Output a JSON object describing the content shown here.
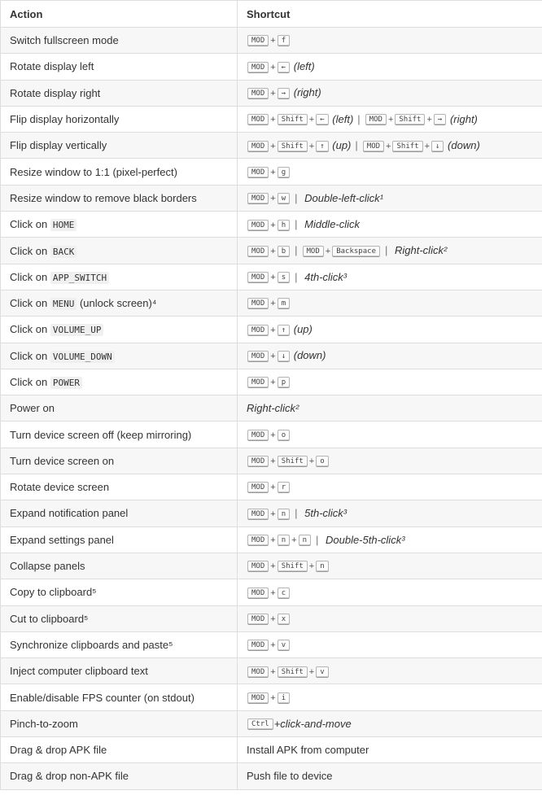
{
  "header": {
    "action": "Action",
    "shortcut": "Shortcut"
  },
  "rows": [
    {
      "action": [
        {
          "t": "Switch fullscreen mode"
        }
      ],
      "shortcut": [
        {
          "k": "MOD"
        },
        {
          "p": "+"
        },
        {
          "k": "f"
        }
      ]
    },
    {
      "action": [
        {
          "t": "Rotate display left"
        }
      ],
      "shortcut": [
        {
          "k": "MOD"
        },
        {
          "p": "+"
        },
        {
          "k": "←"
        },
        {
          "e": "(left)"
        }
      ]
    },
    {
      "action": [
        {
          "t": "Rotate display right"
        }
      ],
      "shortcut": [
        {
          "k": "MOD"
        },
        {
          "p": "+"
        },
        {
          "k": "→"
        },
        {
          "e": "(right)"
        }
      ]
    },
    {
      "action": [
        {
          "t": "Flip display horizontally"
        }
      ],
      "shortcut": [
        {
          "k": "MOD"
        },
        {
          "p": "+"
        },
        {
          "k": "Shift"
        },
        {
          "p": "+"
        },
        {
          "k": "←"
        },
        {
          "e": "(left)"
        },
        {
          "s": "|"
        },
        {
          "k": "MOD"
        },
        {
          "p": "+"
        },
        {
          "k": "Shift"
        },
        {
          "p": "+"
        },
        {
          "k": "→"
        },
        {
          "e": "(right)"
        }
      ]
    },
    {
      "action": [
        {
          "t": "Flip display vertically"
        }
      ],
      "shortcut": [
        {
          "k": "MOD"
        },
        {
          "p": "+"
        },
        {
          "k": "Shift"
        },
        {
          "p": "+"
        },
        {
          "k": "↑"
        },
        {
          "e": "(up)"
        },
        {
          "s": "|"
        },
        {
          "k": "MOD"
        },
        {
          "p": "+"
        },
        {
          "k": "Shift"
        },
        {
          "p": "+"
        },
        {
          "k": "↓"
        },
        {
          "e": "(down)"
        }
      ]
    },
    {
      "action": [
        {
          "t": "Resize window to 1:1 (pixel-perfect)"
        }
      ],
      "shortcut": [
        {
          "k": "MOD"
        },
        {
          "p": "+"
        },
        {
          "k": "g"
        }
      ]
    },
    {
      "action": [
        {
          "t": "Resize window to remove black borders"
        }
      ],
      "shortcut": [
        {
          "k": "MOD"
        },
        {
          "p": "+"
        },
        {
          "k": "w"
        },
        {
          "s": "|"
        },
        {
          "e": "Double-left-click¹"
        }
      ]
    },
    {
      "action": [
        {
          "t": "Click on "
        },
        {
          "c": "HOME"
        }
      ],
      "shortcut": [
        {
          "k": "MOD"
        },
        {
          "p": "+"
        },
        {
          "k": "h"
        },
        {
          "s": "|"
        },
        {
          "e": "Middle-click"
        }
      ]
    },
    {
      "action": [
        {
          "t": "Click on "
        },
        {
          "c": "BACK"
        }
      ],
      "shortcut": [
        {
          "k": "MOD"
        },
        {
          "p": "+"
        },
        {
          "k": "b"
        },
        {
          "s": "|"
        },
        {
          "k": "MOD"
        },
        {
          "p": "+"
        },
        {
          "k": "Backspace"
        },
        {
          "s": "|"
        },
        {
          "e": "Right-click²"
        }
      ]
    },
    {
      "action": [
        {
          "t": "Click on "
        },
        {
          "c": "APP_SWITCH"
        }
      ],
      "shortcut": [
        {
          "k": "MOD"
        },
        {
          "p": "+"
        },
        {
          "k": "s"
        },
        {
          "s": "|"
        },
        {
          "e": "4th-click³"
        }
      ]
    },
    {
      "action": [
        {
          "t": "Click on "
        },
        {
          "c": "MENU"
        },
        {
          "t": " (unlock screen)⁴"
        }
      ],
      "shortcut": [
        {
          "k": "MOD"
        },
        {
          "p": "+"
        },
        {
          "k": "m"
        }
      ]
    },
    {
      "action": [
        {
          "t": "Click on "
        },
        {
          "c": "VOLUME_UP"
        }
      ],
      "shortcut": [
        {
          "k": "MOD"
        },
        {
          "p": "+"
        },
        {
          "k": "↑"
        },
        {
          "e": "(up)"
        }
      ]
    },
    {
      "action": [
        {
          "t": "Click on "
        },
        {
          "c": "VOLUME_DOWN"
        }
      ],
      "shortcut": [
        {
          "k": "MOD"
        },
        {
          "p": "+"
        },
        {
          "k": "↓"
        },
        {
          "e": "(down)"
        }
      ]
    },
    {
      "action": [
        {
          "t": "Click on "
        },
        {
          "c": "POWER"
        }
      ],
      "shortcut": [
        {
          "k": "MOD"
        },
        {
          "p": "+"
        },
        {
          "k": "p"
        }
      ]
    },
    {
      "action": [
        {
          "t": "Power on"
        }
      ],
      "shortcut": [
        {
          "e": "Right-click²"
        }
      ]
    },
    {
      "action": [
        {
          "t": "Turn device screen off (keep mirroring)"
        }
      ],
      "shortcut": [
        {
          "k": "MOD"
        },
        {
          "p": "+"
        },
        {
          "k": "o"
        }
      ]
    },
    {
      "action": [
        {
          "t": "Turn device screen on"
        }
      ],
      "shortcut": [
        {
          "k": "MOD"
        },
        {
          "p": "+"
        },
        {
          "k": "Shift"
        },
        {
          "p": "+"
        },
        {
          "k": "o"
        }
      ]
    },
    {
      "action": [
        {
          "t": "Rotate device screen"
        }
      ],
      "shortcut": [
        {
          "k": "MOD"
        },
        {
          "p": "+"
        },
        {
          "k": "r"
        }
      ]
    },
    {
      "action": [
        {
          "t": "Expand notification panel"
        }
      ],
      "shortcut": [
        {
          "k": "MOD"
        },
        {
          "p": "+"
        },
        {
          "k": "n"
        },
        {
          "s": "|"
        },
        {
          "e": "5th-click³"
        }
      ]
    },
    {
      "action": [
        {
          "t": "Expand settings panel"
        }
      ],
      "shortcut": [
        {
          "k": "MOD"
        },
        {
          "p": "+"
        },
        {
          "k": "n"
        },
        {
          "p": "+"
        },
        {
          "k": "n"
        },
        {
          "s": "|"
        },
        {
          "e": "Double-5th-click³"
        }
      ]
    },
    {
      "action": [
        {
          "t": "Collapse panels"
        }
      ],
      "shortcut": [
        {
          "k": "MOD"
        },
        {
          "p": "+"
        },
        {
          "k": "Shift"
        },
        {
          "p": "+"
        },
        {
          "k": "n"
        }
      ]
    },
    {
      "action": [
        {
          "t": "Copy to clipboard⁵"
        }
      ],
      "shortcut": [
        {
          "k": "MOD"
        },
        {
          "p": "+"
        },
        {
          "k": "c"
        }
      ]
    },
    {
      "action": [
        {
          "t": "Cut to clipboard⁵"
        }
      ],
      "shortcut": [
        {
          "k": "MOD"
        },
        {
          "p": "+"
        },
        {
          "k": "x"
        }
      ]
    },
    {
      "action": [
        {
          "t": "Synchronize clipboards and paste⁵"
        }
      ],
      "shortcut": [
        {
          "k": "MOD"
        },
        {
          "p": "+"
        },
        {
          "k": "v"
        }
      ]
    },
    {
      "action": [
        {
          "t": "Inject computer clipboard text"
        }
      ],
      "shortcut": [
        {
          "k": "MOD"
        },
        {
          "p": "+"
        },
        {
          "k": "Shift"
        },
        {
          "p": "+"
        },
        {
          "k": "v"
        }
      ]
    },
    {
      "action": [
        {
          "t": "Enable/disable FPS counter (on stdout)"
        }
      ],
      "shortcut": [
        {
          "k": "MOD"
        },
        {
          "p": "+"
        },
        {
          "k": "i"
        }
      ]
    },
    {
      "action": [
        {
          "t": "Pinch-to-zoom"
        }
      ],
      "shortcut": [
        {
          "k": "Ctrl"
        },
        {
          "e": "+click-and-move"
        }
      ]
    },
    {
      "action": [
        {
          "t": "Drag & drop APK file"
        }
      ],
      "shortcut": [
        {
          "t": "Install APK from computer"
        }
      ]
    },
    {
      "action": [
        {
          "t": "Drag & drop non-APK file"
        }
      ],
      "shortcut": [
        {
          "t": "Push file to device"
        }
      ]
    }
  ]
}
